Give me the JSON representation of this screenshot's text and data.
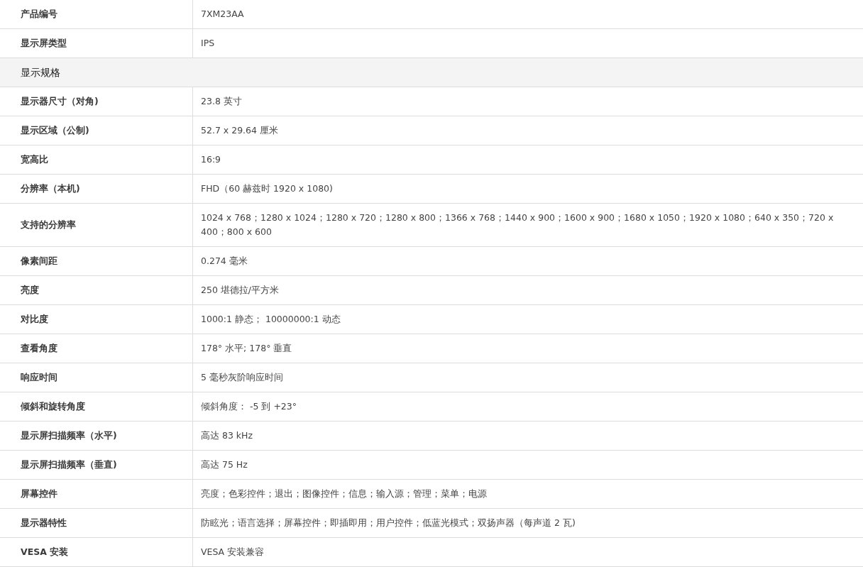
{
  "spec_table": {
    "rows": [
      {
        "kind": "spec",
        "label": "产品编号",
        "value": "7XM23AA"
      },
      {
        "kind": "spec",
        "label": "显示屏类型",
        "value": "IPS"
      },
      {
        "kind": "section",
        "label": "显示规格"
      },
      {
        "kind": "spec",
        "label": "显示器尺寸（对角)",
        "value": "23.8 英寸"
      },
      {
        "kind": "spec",
        "label": "显示区域（公制)",
        "value": "52.7 x 29.64 厘米"
      },
      {
        "kind": "spec",
        "label": "宽高比",
        "value": "16:9"
      },
      {
        "kind": "spec",
        "label": "分辨率（本机)",
        "value": "FHD（60 赫兹时 1920 x 1080)"
      },
      {
        "kind": "spec",
        "label": "支持的分辨率",
        "value": "1024 x 768；1280 x 1024；1280 x 720；1280 x 800；1366 x 768；1440 x 900；1600 x 900；1680 x 1050；1920 x 1080；640 x 350；720 x 400；800 x 600"
      },
      {
        "kind": "spec",
        "label": "像素间距",
        "value": "0.274 毫米"
      },
      {
        "kind": "spec",
        "label": "亮度",
        "value": "250 堪德拉/平方米"
      },
      {
        "kind": "spec",
        "label": "对比度",
        "value": "1000:1 静态； 10000000:1 动态"
      },
      {
        "kind": "spec",
        "label": "查看角度",
        "value": "178° 水平; 178° 垂直"
      },
      {
        "kind": "spec",
        "label": "响应时间",
        "value": "5 毫秒灰阶响应时间"
      },
      {
        "kind": "spec",
        "label": "倾斜和旋转角度",
        "value": "倾斜角度： -5 到 +23°"
      },
      {
        "kind": "spec",
        "label": "显示屏扫描频率（水平)",
        "value": "高达 83 kHz"
      },
      {
        "kind": "spec",
        "label": "显示屏扫描频率（垂直)",
        "value": "高达 75 Hz"
      },
      {
        "kind": "spec",
        "label": "屏幕控件",
        "value": "亮度；色彩控件；退出；图像控件；信息；输入源；管理；菜单；电源"
      },
      {
        "kind": "spec",
        "label": "显示器特性",
        "value": "防眩光；语言选择；屏幕控件；即插即用；用户控件；低蓝光模式；双扬声器（每声道 2 瓦)"
      },
      {
        "kind": "spec",
        "label": "VESA 安装",
        "value": "VESA 安装兼容"
      }
    ]
  }
}
